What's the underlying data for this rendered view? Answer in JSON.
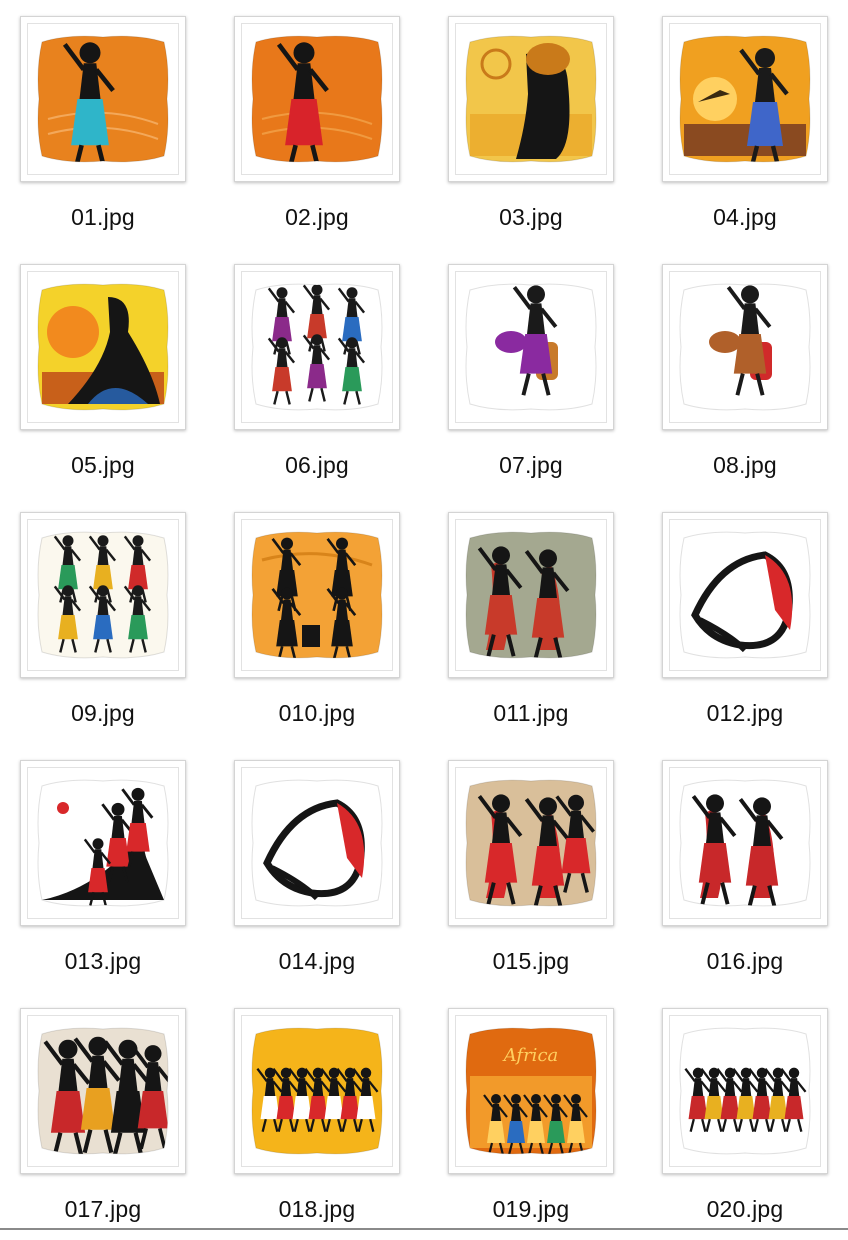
{
  "files": [
    {
      "name": "01.jpg",
      "thumb_icon": "orange-woman-pillow-icon",
      "bg": "#e8821e",
      "accent": "#f3a85a",
      "figure": "#151515",
      "hi": "#2fb5c9"
    },
    {
      "name": "02.jpg",
      "thumb_icon": "orange-woman-pillow-icon",
      "bg": "#e8781a",
      "accent": "#f09a40",
      "figure": "#151515",
      "hi": "#d8232a"
    },
    {
      "name": "03.jpg",
      "thumb_icon": "yellow-portrait-pillow-icon",
      "bg": "#f2c64a",
      "accent": "#e8a020",
      "figure": "#151515",
      "hi": "#c97a1a"
    },
    {
      "name": "04.jpg",
      "thumb_icon": "sunset-woman-pillow-icon",
      "bg": "#f0a020",
      "accent": "#8a4a20",
      "figure": "#1a1a1a",
      "hi": "#3f66c9"
    },
    {
      "name": "05.jpg",
      "thumb_icon": "sun-woman-pillow-icon",
      "bg": "#f4d22a",
      "accent": "#f28a1e",
      "figure": "#151515",
      "hi": "#2a6cc0"
    },
    {
      "name": "06.jpg",
      "thumb_icon": "dancers-pillow-icon",
      "bg": "#ffffff",
      "accent": "#8b2a8a",
      "figure": "#1a1a1a",
      "hi": "#c83a2a"
    },
    {
      "name": "07.jpg",
      "thumb_icon": "drummer-pillow-icon",
      "bg": "#ffffff",
      "accent": "#8a2aa0",
      "figure": "#1a1a1a",
      "hi": "#c87a2a"
    },
    {
      "name": "08.jpg",
      "thumb_icon": "drummer-pillow-icon",
      "bg": "#ffffff",
      "accent": "#b0602a",
      "figure": "#1a1a1a",
      "hi": "#d02a2a"
    },
    {
      "name": "09.jpg",
      "thumb_icon": "women-group-pillow-icon",
      "bg": "#fbf8ee",
      "accent": "#e8b020",
      "figure": "#1a1a1a",
      "hi": "#2a9a5a"
    },
    {
      "name": "010.jpg",
      "thumb_icon": "musicians-pillow-icon",
      "bg": "#f3a236",
      "accent": "#d8841a",
      "figure": "#151515",
      "hi": "#ffffff"
    },
    {
      "name": "011.jpg",
      "thumb_icon": "dancers-pillow-icon",
      "bg": "#a4a890",
      "accent": "#c83a2a",
      "figure": "#151515",
      "hi": "#ffffff"
    },
    {
      "name": "012.jpg",
      "thumb_icon": "abstract-dancer-pillow-icon",
      "bg": "#ffffff",
      "accent": "#d8282a",
      "figure": "#151515",
      "hi": "#ffffff"
    },
    {
      "name": "013.jpg",
      "thumb_icon": "women-hill-pillow-icon",
      "bg": "#ffffff",
      "accent": "#d8282a",
      "figure": "#151515",
      "hi": "#ffffff"
    },
    {
      "name": "014.jpg",
      "thumb_icon": "abstract-dancer-pillow-icon",
      "bg": "#ffffff",
      "accent": "#d8282a",
      "figure": "#151515",
      "hi": "#888888"
    },
    {
      "name": "015.jpg",
      "thumb_icon": "dancers-pillow-icon",
      "bg": "#d9bf9a",
      "accent": "#d8282a",
      "figure": "#151515",
      "hi": "#ffffff"
    },
    {
      "name": "016.jpg",
      "thumb_icon": "dancers-pillow-icon",
      "bg": "#ffffff",
      "accent": "#c8282a",
      "figure": "#151515",
      "hi": "#ffffff"
    },
    {
      "name": "017.jpg",
      "thumb_icon": "women-group-pillow-icon",
      "bg": "#e9e0d2",
      "accent": "#c8282a",
      "figure": "#151515",
      "hi": "#e8a020"
    },
    {
      "name": "018.jpg",
      "thumb_icon": "dancers-row-pillow-icon",
      "bg": "#f5b41a",
      "accent": "#d8282a",
      "figure": "#151515",
      "hi": "#ffffff"
    },
    {
      "name": "019.jpg",
      "thumb_icon": "africa-landscape-pillow-icon",
      "bg": "#e06a10",
      "accent": "#f29a2a",
      "figure": "#151515",
      "hi": "#ffd060"
    },
    {
      "name": "020.jpg",
      "thumb_icon": "dancers-row-pillow-icon",
      "bg": "#ffffff",
      "accent": "#e8b020",
      "figure": "#151515",
      "hi": "#c8282a"
    }
  ]
}
